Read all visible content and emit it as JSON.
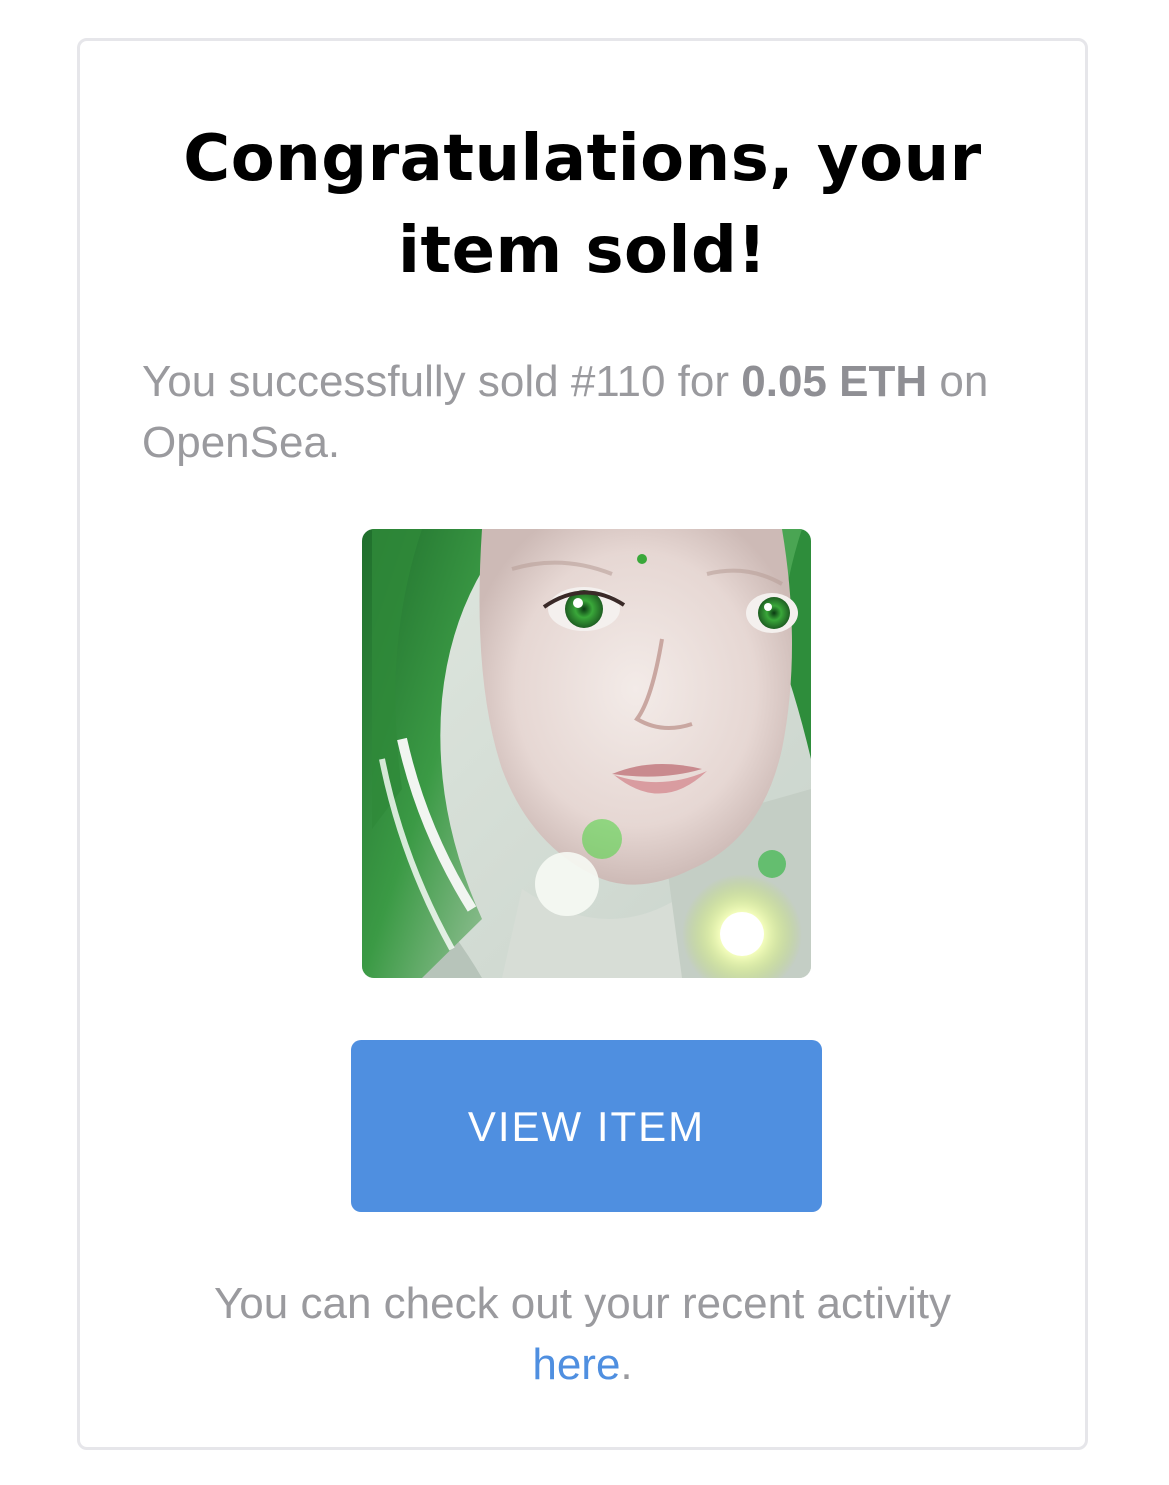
{
  "notification": {
    "title_line1": "Congratulations, your",
    "title_line2": "item sold!",
    "message_prefix": "You successfully sold #110 for ",
    "price": "0.05 ETH",
    "message_suffix": " on OpenSea.",
    "button_label": "VIEW ITEM",
    "footer_text": "You can check out your recent activity",
    "footer_link": "here",
    "footer_end": "."
  },
  "colors": {
    "accent": "#4f8fe0",
    "text_muted": "#9a9a9e",
    "border": "#e6e6ea"
  }
}
